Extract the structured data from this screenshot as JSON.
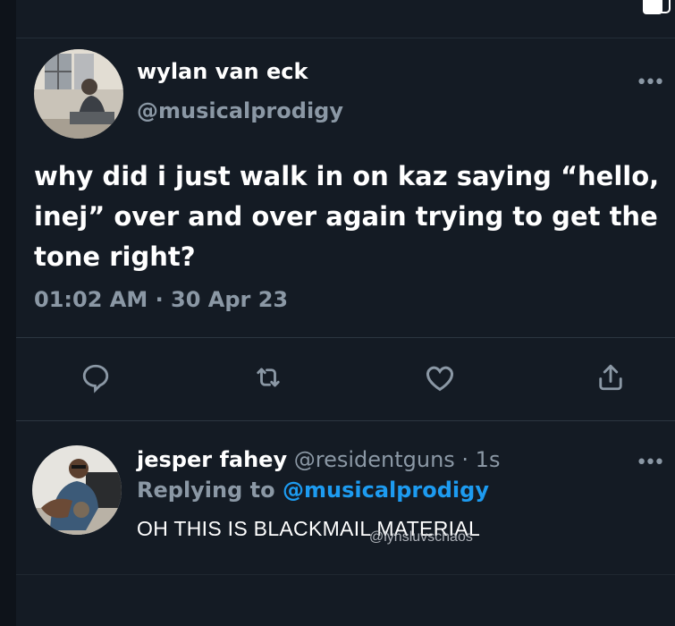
{
  "tweet": {
    "author_name": "wylan van eck",
    "author_handle": "@musicalprodigy",
    "text": "why did i just walk in on kaz saying “hello, inej” over and over again trying to get the tone right?",
    "timestamp": "01:02 AM · 30 Apr 23",
    "more_icon": "•••"
  },
  "actions": {
    "icons": [
      "reply-icon",
      "retweet-icon",
      "like-icon",
      "share-icon"
    ]
  },
  "reply": {
    "author_name": "jesper fahey",
    "author_handle": "@residentguns · 1s",
    "replying_label": "Replying to",
    "replying_mention": "@musicalprodigy",
    "text": "OH THIS IS BLACKMAIL MATERIAL",
    "more_icon": "•••"
  },
  "watermark": "@lynsluvschaos",
  "colors": {
    "background": "#141b24",
    "secondary_text": "#8b98a5",
    "accent": "#1d9bf0"
  }
}
